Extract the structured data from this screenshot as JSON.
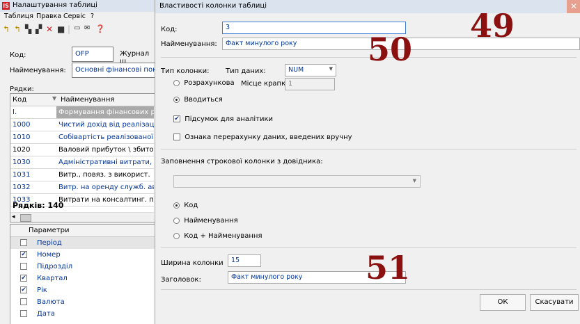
{
  "bg": {
    "title": "Налаштування таблиці",
    "menu": [
      "Таблиця",
      "Правка",
      "Сервіс",
      "?"
    ],
    "code_label": "Код:",
    "code_value": "OFP",
    "journal_label": "Журнал ш",
    "name_label": "Найменування:",
    "name_value": "Основні фінансові пока",
    "rows_label": "Рядки:",
    "col_code": "Код",
    "col_name": "Найменування",
    "rows": [
      {
        "code": "I.",
        "name": "Формування фінансових ре"
      },
      {
        "code": "1000",
        "name": "Чистий дохід від реалізації"
      },
      {
        "code": "1010",
        "name": "Собівартість реалізованої п"
      },
      {
        "code": "1020",
        "name": "Валовий прибуток \\ збиток"
      },
      {
        "code": "1030",
        "name": "Адміністративні витрати, у"
      },
      {
        "code": "1031",
        "name": "Витр., повяз. з використ."
      },
      {
        "code": "1032",
        "name": "Витр. на оренду служб. ав"
      },
      {
        "code": "1033",
        "name": "Витрати на консалтинг. по"
      }
    ],
    "rows_count": "Рядків: 140",
    "params_header": "Параметри",
    "params": [
      {
        "label": "Період",
        "checked": false
      },
      {
        "label": "Номер",
        "checked": true
      },
      {
        "label": "Підрозділ",
        "checked": false
      },
      {
        "label": "Квартал",
        "checked": true
      },
      {
        "label": "Рік",
        "checked": true
      },
      {
        "label": "Валюта",
        "checked": false
      },
      {
        "label": "Дата",
        "checked": false
      }
    ]
  },
  "dlg": {
    "title": "Властивості колонки таблиці",
    "close": "✕",
    "code_label": "Код:",
    "code_value": "3",
    "name_label": "Найменування:",
    "name_value": "Факт минулого року",
    "col_type_label": "Тип колонки:",
    "data_type_label": "Тип даних:",
    "data_type_value": "NUM",
    "radio_calc": "Розрахункова",
    "decimal_label": "Місце крапки",
    "decimal_value": "1",
    "radio_input": "Вводиться",
    "chk_total": "Підсумок для аналітики",
    "chk_recalc": "Ознака перерахунку даних, введених вручну",
    "fill_label": "Заповнення строкової колонки з довідника:",
    "opt_code": "Код",
    "opt_name": "Найменування",
    "opt_both": "Код + Найменування",
    "width_label": "Ширина колонки",
    "width_value": "15",
    "header_label": "Заголовок:",
    "header_value": "Факт минулого року",
    "ok": "ОК",
    "cancel": "Скасувати"
  },
  "annotations": [
    "49",
    "50",
    "51"
  ]
}
